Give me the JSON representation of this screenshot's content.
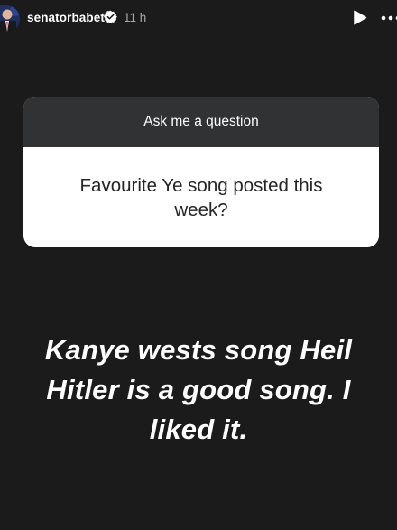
{
  "header": {
    "username": "senatorbabet",
    "timestamp": "11 h",
    "verified_icon": "verified-badge-icon",
    "play_icon": "play-icon",
    "more_icon": "more-options-icon"
  },
  "question_sticker": {
    "prompt": "Ask me a question",
    "question": "Favourite Ye song posted this week?"
  },
  "answer": {
    "text": "Kanye wests song Heil Hitler is a good song. I liked it."
  },
  "colors": {
    "background": "#1b1b1b",
    "sticker_header": "#303234",
    "sticker_body": "#ffffff",
    "text_primary": "#ffffff",
    "text_secondary": "#a8a8a8"
  }
}
